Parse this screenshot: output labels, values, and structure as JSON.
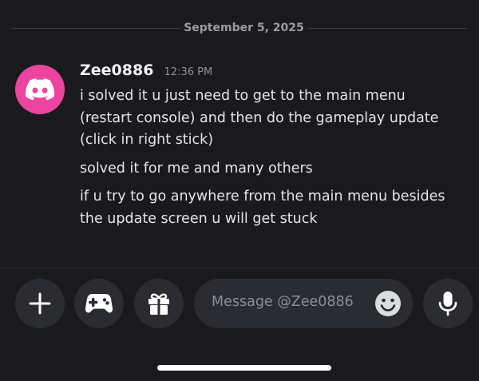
{
  "date_divider": "September 5, 2025",
  "message": {
    "username": "Zee0886",
    "timestamp": "12:36 PM",
    "avatar_color": "#eb459f",
    "paragraphs": [
      [
        "i solved it u just need to get to the main menu",
        "(restart console) and then do the gameplay update",
        "(click in right stick)"
      ],
      [
        "solved it for me and many others"
      ],
      [
        "if u try to go anywhere from the main menu besides",
        "the update screen u will get stuck"
      ]
    ]
  },
  "composer": {
    "placeholder": "Message @Zee0886",
    "buttons": [
      "plus-icon",
      "gamepad-icon",
      "gift-icon",
      "emoji-icon",
      "microphone-icon"
    ]
  }
}
